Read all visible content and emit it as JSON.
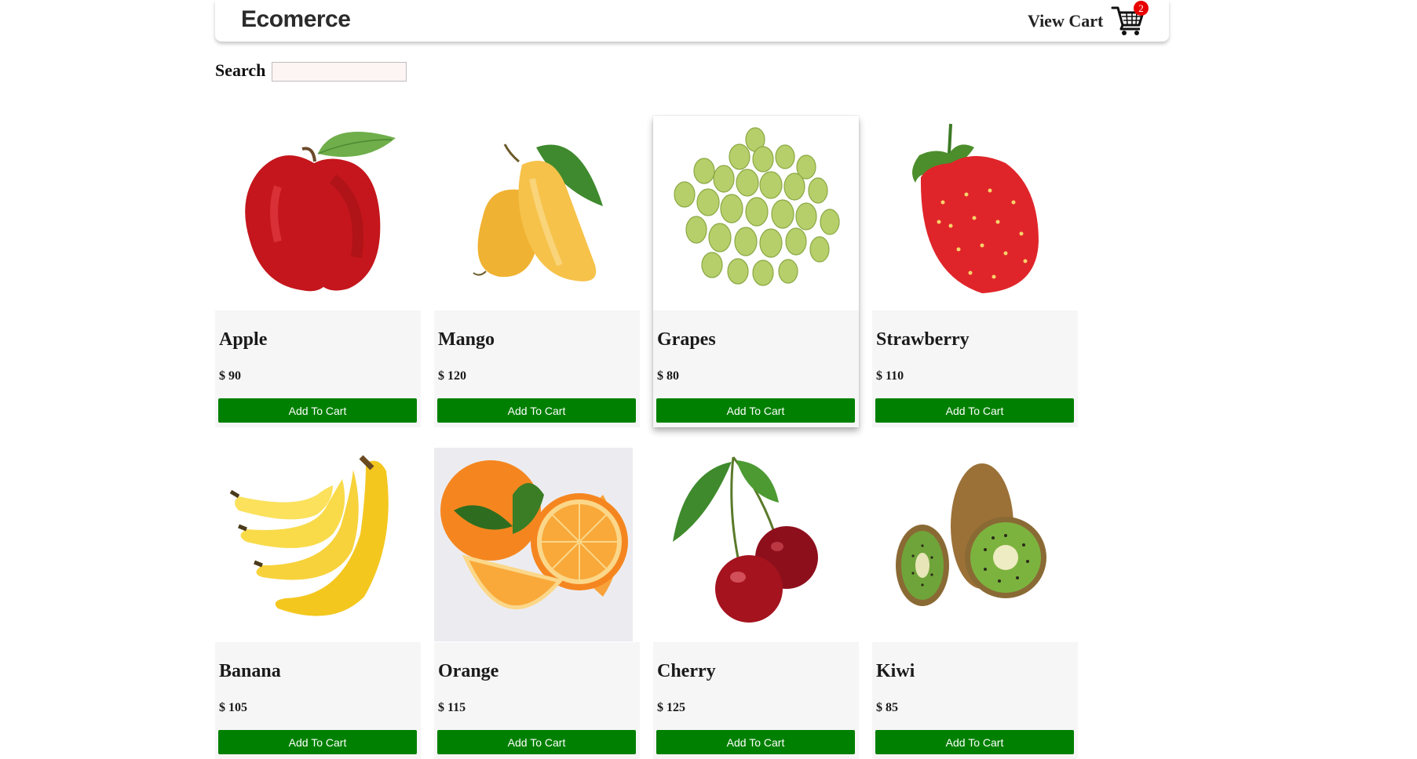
{
  "header": {
    "brand": "Ecomerce",
    "view_cart_label": "View Cart",
    "cart_count": "2"
  },
  "search": {
    "label": "Search",
    "value": "",
    "placeholder": ""
  },
  "products": [
    {
      "name": "Apple",
      "price": "$ 90",
      "button": "Add To Cart",
      "image": "apple"
    },
    {
      "name": "Mango",
      "price": "$ 120",
      "button": "Add To Cart",
      "image": "mango"
    },
    {
      "name": "Grapes",
      "price": "$ 80",
      "button": "Add To Cart",
      "image": "grapes"
    },
    {
      "name": "Strawberry",
      "price": "$ 110",
      "button": "Add To Cart",
      "image": "strawberry"
    },
    {
      "name": "Banana",
      "price": "$ 105",
      "button": "Add To Cart",
      "image": "banana"
    },
    {
      "name": "Orange",
      "price": "$ 115",
      "button": "Add To Cart",
      "image": "orange"
    },
    {
      "name": "Cherry",
      "price": "$ 125",
      "button": "Add To Cart",
      "image": "cherry"
    },
    {
      "name": "Kiwi",
      "price": "$ 85",
      "button": "Add To Cart",
      "image": "kiwi"
    }
  ],
  "colors": {
    "button": "#008000",
    "badge": "#e80000",
    "card_body": "#f6f6f6"
  }
}
